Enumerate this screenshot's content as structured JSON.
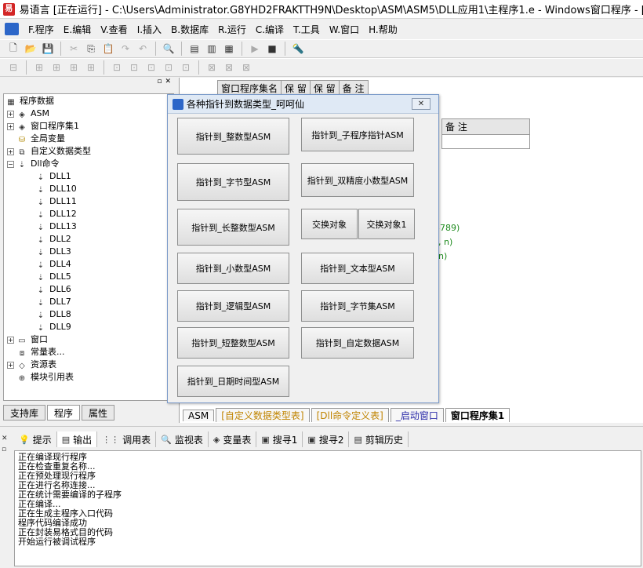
{
  "window": {
    "title": "易语言 [正在运行] - C:\\Users\\Administrator.G8YHD2FRAKTTH9N\\Desktop\\ASM\\ASM5\\DLL应用1\\主程序1.e - Windows窗口程序 - [程序集: 窗口"
  },
  "menu": [
    "F.程序",
    "E.编辑",
    "V.查看",
    "I.插入",
    "B.数据库",
    "R.运行",
    "C.编译",
    "T.工具",
    "W.窗口",
    "H.帮助"
  ],
  "tree": {
    "root": "程序数据",
    "asm": "ASM",
    "window_program_set": "窗口程序集1",
    "global_vars": "全局变量",
    "custom_types": "自定义数据类型",
    "dll_commands": "Dll命令",
    "dll_items": [
      "DLL1",
      "DLL10",
      "DLL11",
      "DLL12",
      "DLL13",
      "DLL2",
      "DLL3",
      "DLL4",
      "DLL5",
      "DLL6",
      "DLL7",
      "DLL8",
      "DLL9"
    ],
    "window": "窗口",
    "constants": "常量表...",
    "resources": "资源表",
    "module_refs": "模块引用表"
  },
  "left_tabs": [
    "支持库",
    "程序",
    "属性"
  ],
  "editor": {
    "header": [
      "窗口程序集名",
      "保 留",
      "保 留",
      "备 注"
    ],
    "header2_note": "备 注",
    "code_fragments": [
      "3789)",
      ", n)",
      "n)"
    ],
    "tabs": [
      "ASM",
      "[自定义数据类型表]",
      "[Dll命令定义表]",
      "_启动窗口",
      "窗口程序集1"
    ]
  },
  "dialog": {
    "title": "各种指针到数据类型_呵呵仙",
    "close_label": "✕",
    "buttons": {
      "b1": "指针到_整数型ASM",
      "b2": "指针到_子程序指针ASM",
      "b3": "指针到_字节型ASM",
      "b4": "指针到_双精度小数型ASM",
      "b5": "指针到_长整数型ASM",
      "b6": "交换对象",
      "b7": "交换对象1",
      "b8": "指针到_小数型ASM",
      "b9": "指针到_文本型ASM",
      "b10": "指针到_逻辑型ASM",
      "b11": "指针到_字节集ASM",
      "b12": "指针到_短整数型ASM",
      "b13": "指针到_自定数据ASM",
      "b14": "指针到_日期时间型ASM"
    }
  },
  "output": {
    "tabs": [
      "提示",
      "输出",
      "调用表",
      "监视表",
      "变量表",
      "搜寻1",
      "搜寻2",
      "剪辑历史"
    ],
    "lines": [
      "正在编译现行程序",
      "正在检查重复名称...",
      "正在预处理现行程序",
      "正在进行名称连接...",
      "正在统计需要编译的子程序",
      "正在编译...",
      "正在生成主程序入口代码",
      "程序代码编译成功",
      "正在封装易格式目的代码",
      "开始运行被调试程序"
    ]
  }
}
